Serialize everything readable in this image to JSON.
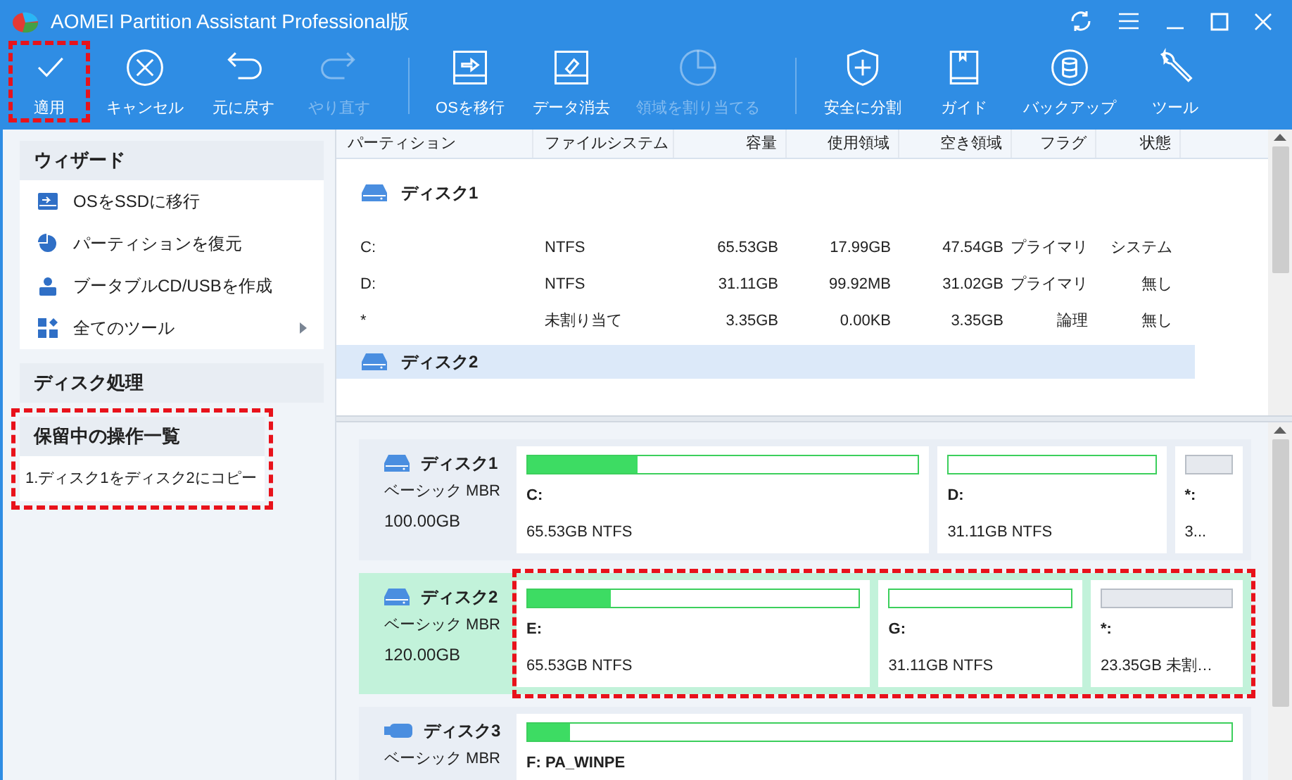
{
  "window": {
    "title": "AOMEI Partition Assistant Professional版"
  },
  "toolbar": [
    {
      "label": "適用",
      "disabled": false,
      "highlighted": true
    },
    {
      "label": "キャンセル",
      "disabled": false,
      "highlighted": false
    },
    {
      "label": "元に戻す",
      "disabled": false,
      "highlighted": false
    },
    {
      "label": "やり直す",
      "disabled": true,
      "highlighted": false
    },
    {
      "label": "OSを移行",
      "disabled": false,
      "highlighted": false
    },
    {
      "label": "データ消去",
      "disabled": false,
      "highlighted": false
    },
    {
      "label": "領域を割り当てる",
      "disabled": true,
      "highlighted": false
    },
    {
      "label": "安全に分割",
      "disabled": false,
      "highlighted": false
    },
    {
      "label": "ガイド",
      "disabled": false,
      "highlighted": false
    },
    {
      "label": "バックアップ",
      "disabled": false,
      "highlighted": false
    },
    {
      "label": "ツール",
      "disabled": false,
      "highlighted": false
    }
  ],
  "sidebar": {
    "sections": [
      {
        "title": "ウィザード",
        "highlighted": false,
        "items": [
          {
            "label": "OSをSSDに移行",
            "submenu": false
          },
          {
            "label": "パーティションを復元",
            "submenu": false
          },
          {
            "label": "ブータブルCD/USBを作成",
            "submenu": false
          },
          {
            "label": "全てのツール",
            "submenu": true
          }
        ]
      },
      {
        "title": "ディスク処理",
        "highlighted": false
      },
      {
        "title": "保留中の操作一覧",
        "highlighted": true,
        "items": [
          {
            "label": "1.ディスク1をディスク2にコピー"
          }
        ]
      }
    ]
  },
  "table": {
    "columns": [
      "パーティション",
      "ファイルシステム",
      "容量",
      "使用領域",
      "空き領域",
      "フラグ",
      "状態"
    ],
    "disks": [
      {
        "name": "ディスク1",
        "selected": false,
        "rows": [
          [
            "C:",
            "NTFS",
            "65.53GB",
            "17.99GB",
            "47.54GB",
            "プライマリ",
            "システム"
          ],
          [
            "D:",
            "NTFS",
            "31.11GB",
            "99.92MB",
            "31.02GB",
            "プライマリ",
            "無し"
          ],
          [
            "*",
            "未割り当て",
            "3.35GB",
            "0.00KB",
            "3.35GB",
            "論理",
            "無し"
          ]
        ]
      },
      {
        "name": "ディスク2",
        "selected": true
      }
    ]
  },
  "disk_map": [
    {
      "name": "ディスク1",
      "kind": "disk",
      "type": "ベーシック MBR",
      "size": "100.00GB",
      "selected": false,
      "highlighted": false,
      "partitions": [
        {
          "label": "C:",
          "info": "65.53GB NTFS",
          "kind": "used",
          "level": 0.28
        },
        {
          "label": "D:",
          "info": "31.11GB NTFS",
          "kind": "used",
          "level": 0
        },
        {
          "label": "*:",
          "info": "3...",
          "kind": "unallocated",
          "level": 0
        }
      ]
    },
    {
      "name": "ディスク2",
      "kind": "disk",
      "type": "ベーシック MBR",
      "size": "120.00GB",
      "selected": true,
      "highlighted": true,
      "partitions": [
        {
          "label": "E:",
          "info": "65.53GB NTFS",
          "kind": "used",
          "level": 0.25
        },
        {
          "label": "G:",
          "info": "31.11GB NTFS",
          "kind": "used",
          "level": 0
        },
        {
          "label": "*:",
          "info": "23.35GB 未割…",
          "kind": "unallocated",
          "level": 0
        }
      ]
    },
    {
      "name": "ディスク3",
      "kind": "usb",
      "type": "ベーシック MBR",
      "selected": false,
      "highlighted": false,
      "partitions": [
        {
          "label": "F: PA_WINPE",
          "kind": "used",
          "level": 0.06
        }
      ]
    }
  ]
}
